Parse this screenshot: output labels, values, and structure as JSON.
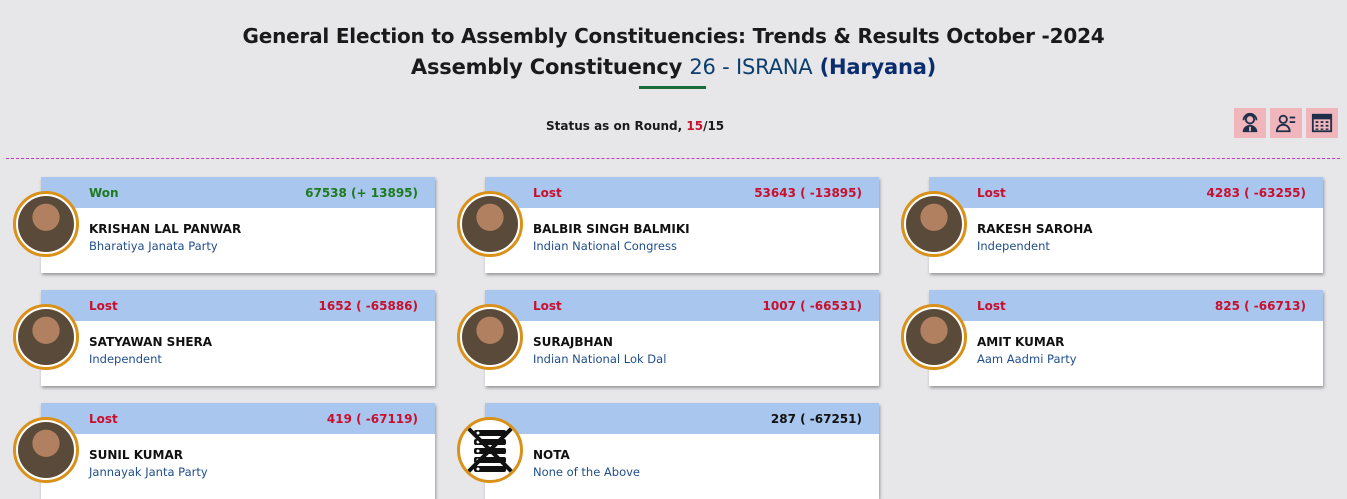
{
  "header": {
    "title": "General Election to Assembly Constituencies: Trends & Results October -2024",
    "subtitle_prefix": "Assembly Constituency",
    "constituency": "26 - ISRANA",
    "state": "(Haryana)"
  },
  "status": {
    "label": "Status as on Round,",
    "round": "15",
    "total": "/15"
  },
  "toolbar": {
    "icons": [
      "user-support-icon",
      "user-list-icon",
      "calculator-icon"
    ]
  },
  "candidates": [
    {
      "status": "Won",
      "votes": "67538 (+ 13895)",
      "name": "KRISHAN LAL PANWAR",
      "party": "Bharatiya Janata Party"
    },
    {
      "status": "Lost",
      "votes": "53643 ( -13895)",
      "name": "BALBIR SINGH BALMIKI",
      "party": "Indian National Congress"
    },
    {
      "status": "Lost",
      "votes": "4283 ( -63255)",
      "name": "RAKESH SAROHA",
      "party": "Independent"
    },
    {
      "status": "Lost",
      "votes": "1652 ( -65886)",
      "name": "SATYAWAN SHERA",
      "party": "Independent"
    },
    {
      "status": "Lost",
      "votes": "1007 ( -66531)",
      "name": "SURAJBHAN",
      "party": "Indian National Lok Dal"
    },
    {
      "status": "Lost",
      "votes": "825 ( -66713)",
      "name": "AMIT KUMAR",
      "party": "Aam Aadmi Party"
    },
    {
      "status": "Lost",
      "votes": "419 ( -67119)",
      "name": "SUNIL KUMAR",
      "party": "Jannayak Janta Party"
    },
    {
      "status": "",
      "votes": "287 ( -67251)",
      "name": "NOTA",
      "party": "None of the Above"
    }
  ],
  "colors": {
    "won": "#1e7a1e",
    "lost": "#c8102e",
    "card_header": "#a9c6ef",
    "avatar_ring": "#d9911a",
    "divider": "#c03ac6"
  }
}
